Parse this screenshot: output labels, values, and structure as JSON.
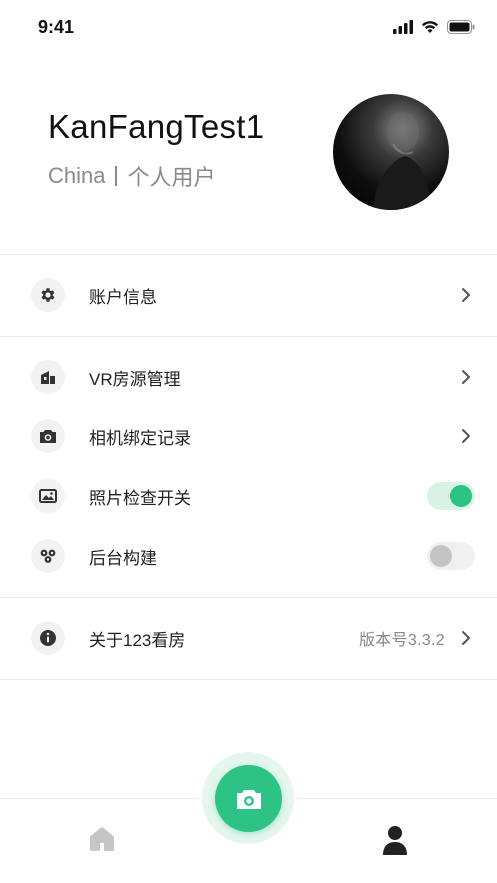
{
  "status_bar": {
    "time": "9:41"
  },
  "profile": {
    "username": "KanFangTest1",
    "region": "China",
    "account_type": "个人用户"
  },
  "menu": {
    "account_info": {
      "label": "账户信息",
      "icon": "gear-icon"
    },
    "vr_listing": {
      "label": "VR房源管理",
      "icon": "house-icon"
    },
    "camera_binding": {
      "label": "相机绑定记录",
      "icon": "camera-icon"
    },
    "photo_check": {
      "label": "照片检查开关",
      "icon": "image-icon",
      "enabled": true
    },
    "background_build": {
      "label": "后台构建",
      "icon": "cluster-icon",
      "enabled": false
    },
    "about": {
      "label": "关于123看房",
      "icon": "info-icon",
      "version": "版本号3.3.2"
    }
  },
  "tabbar": {
    "home_icon": "home-icon",
    "camera_icon": "camera-icon",
    "me_icon": "person-icon"
  },
  "colors": {
    "accent": "#2cc384",
    "accent_light": "#d7f3e6",
    "text_muted": "#8a8a8a"
  }
}
